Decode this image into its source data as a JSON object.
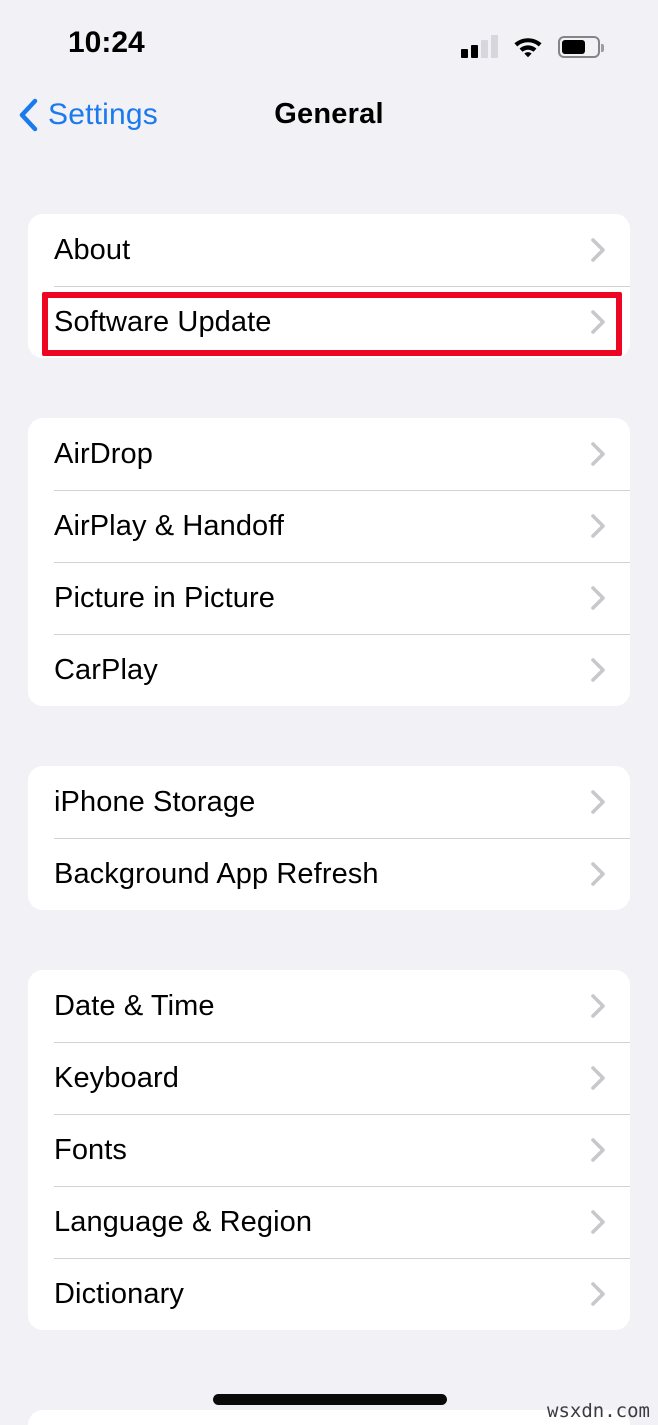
{
  "status_bar": {
    "time": "10:24",
    "signal_icon": "cellular-signal-icon",
    "signal_bars_filled": 2,
    "signal_bars_total": 4,
    "wifi_icon": "wifi-icon",
    "battery_icon": "battery-icon",
    "battery_level_percent": 62
  },
  "nav": {
    "back_label": "Settings",
    "back_icon": "chevron-left-icon",
    "title": "General"
  },
  "groups": [
    {
      "id": "group-system",
      "rows": [
        {
          "label": "About",
          "chevron": "chevron-right-icon"
        },
        {
          "label": "Software Update",
          "chevron": "chevron-right-icon",
          "highlighted": true
        }
      ]
    },
    {
      "id": "group-connectivity",
      "rows": [
        {
          "label": "AirDrop",
          "chevron": "chevron-right-icon"
        },
        {
          "label": "AirPlay & Handoff",
          "chevron": "chevron-right-icon"
        },
        {
          "label": "Picture in Picture",
          "chevron": "chevron-right-icon"
        },
        {
          "label": "CarPlay",
          "chevron": "chevron-right-icon"
        }
      ]
    },
    {
      "id": "group-storage",
      "rows": [
        {
          "label": "iPhone Storage",
          "chevron": "chevron-right-icon"
        },
        {
          "label": "Background App Refresh",
          "chevron": "chevron-right-icon"
        }
      ]
    },
    {
      "id": "group-localization",
      "rows": [
        {
          "label": "Date & Time",
          "chevron": "chevron-right-icon"
        },
        {
          "label": "Keyboard",
          "chevron": "chevron-right-icon"
        },
        {
          "label": "Fonts",
          "chevron": "chevron-right-icon"
        },
        {
          "label": "Language & Region",
          "chevron": "chevron-right-icon"
        },
        {
          "label": "Dictionary",
          "chevron": "chevron-right-icon"
        }
      ]
    }
  ],
  "annotation": {
    "target_row_label": "Software Update",
    "box_color": "#ec0622"
  },
  "home_indicator": "home-indicator",
  "watermark": "wsxdn.com",
  "colors": {
    "background": "#f2f1f6",
    "card": "#ffffff",
    "separator": "#d3d3d6",
    "accent_blue": "#1a7aee",
    "chevron_gray": "#c7c7cc",
    "text_primary": "#000000",
    "annotation_red": "#ec0622"
  }
}
